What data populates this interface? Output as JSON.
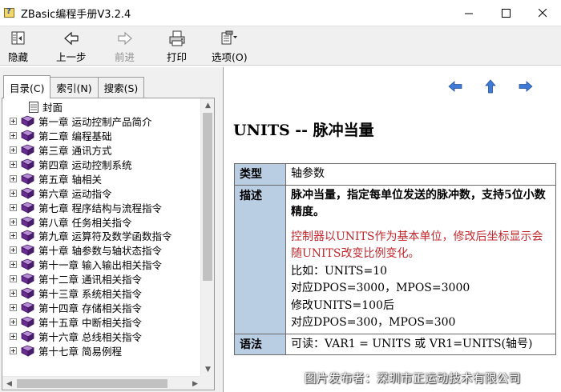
{
  "window": {
    "title": "ZBasic编程手册V3.2.4",
    "controls": {
      "minimize": "—",
      "maximize": "☐",
      "close": "✕"
    }
  },
  "toolbar": {
    "buttons": [
      {
        "label": "隐藏",
        "icon": "hide-pane-icon",
        "enabled": true
      },
      {
        "label": "上一步",
        "icon": "back-arrow-icon",
        "enabled": true
      },
      {
        "label": "前进",
        "icon": "forward-arrow-icon",
        "enabled": false
      },
      {
        "label": "打印",
        "icon": "printer-icon",
        "enabled": true
      },
      {
        "label": "选项(O)",
        "icon": "options-icon",
        "enabled": true
      }
    ]
  },
  "left_pane": {
    "tabs": [
      {
        "label": "目录(C)",
        "active": true
      },
      {
        "label": "索引(N)",
        "active": false
      },
      {
        "label": "搜索(S)",
        "active": false
      }
    ],
    "tree": [
      {
        "label": "封面",
        "type": "page"
      },
      {
        "label": "第一章  运动控制产品简介",
        "type": "book"
      },
      {
        "label": "第二章  编程基础",
        "type": "book"
      },
      {
        "label": "第三章  通讯方式",
        "type": "book"
      },
      {
        "label": "第四章  运动控制系统",
        "type": "book"
      },
      {
        "label": "第五章  轴相关",
        "type": "book"
      },
      {
        "label": "第六章  运动指令",
        "type": "book"
      },
      {
        "label": "第七章  程序结构与流程指令",
        "type": "book"
      },
      {
        "label": "第八章  任务相关指令",
        "type": "book"
      },
      {
        "label": "第九章  运算符及数学函数指令",
        "type": "book"
      },
      {
        "label": "第十章  轴参数与轴状态指令",
        "type": "book"
      },
      {
        "label": "第十一章  输入输出相关指令",
        "type": "book"
      },
      {
        "label": "第十二章  通讯相关指令",
        "type": "book"
      },
      {
        "label": "第十三章  系统相关指令",
        "type": "book"
      },
      {
        "label": "第十四章  存储相关指令",
        "type": "book"
      },
      {
        "label": "第十五章  中断相关指令",
        "type": "book"
      },
      {
        "label": "第十六章  总线相关指令",
        "type": "book"
      },
      {
        "label": "第十七章  简易例程",
        "type": "book"
      }
    ]
  },
  "content": {
    "nav": [
      "prev-topic-icon",
      "up-topic-icon",
      "next-topic-icon"
    ],
    "title": "UNITS -- 脉冲当量",
    "rows": {
      "type_key": "类型",
      "type_val": "轴参数",
      "desc_key": "描述",
      "desc_bold": "脉冲当量，指定每单位发送的脉冲数，支持5位小数精度。",
      "desc_red": "控制器以UNITS作为基本单位，修改后坐标显示会随UNITS改变比例变化。",
      "desc_lines": [
        "比如：UNITS=10",
        "对应DPOS=3000，MPOS=3000",
        "修改UNITS=100后",
        "对应DPOS=300，MPOS=300"
      ],
      "syntax_key": "语法",
      "syntax_val": "可读：VAR1 = UNITS    或 VR1=UNITS(轴号)"
    },
    "watermark": "图片发布者：深圳市正运动技术有限公司"
  },
  "colors": {
    "table_header_bg": "#b9cde3",
    "highlight_red": "#c0282d",
    "nav_arrow_blue": "#3f7ad6",
    "book_purple": "#6b2c91"
  }
}
